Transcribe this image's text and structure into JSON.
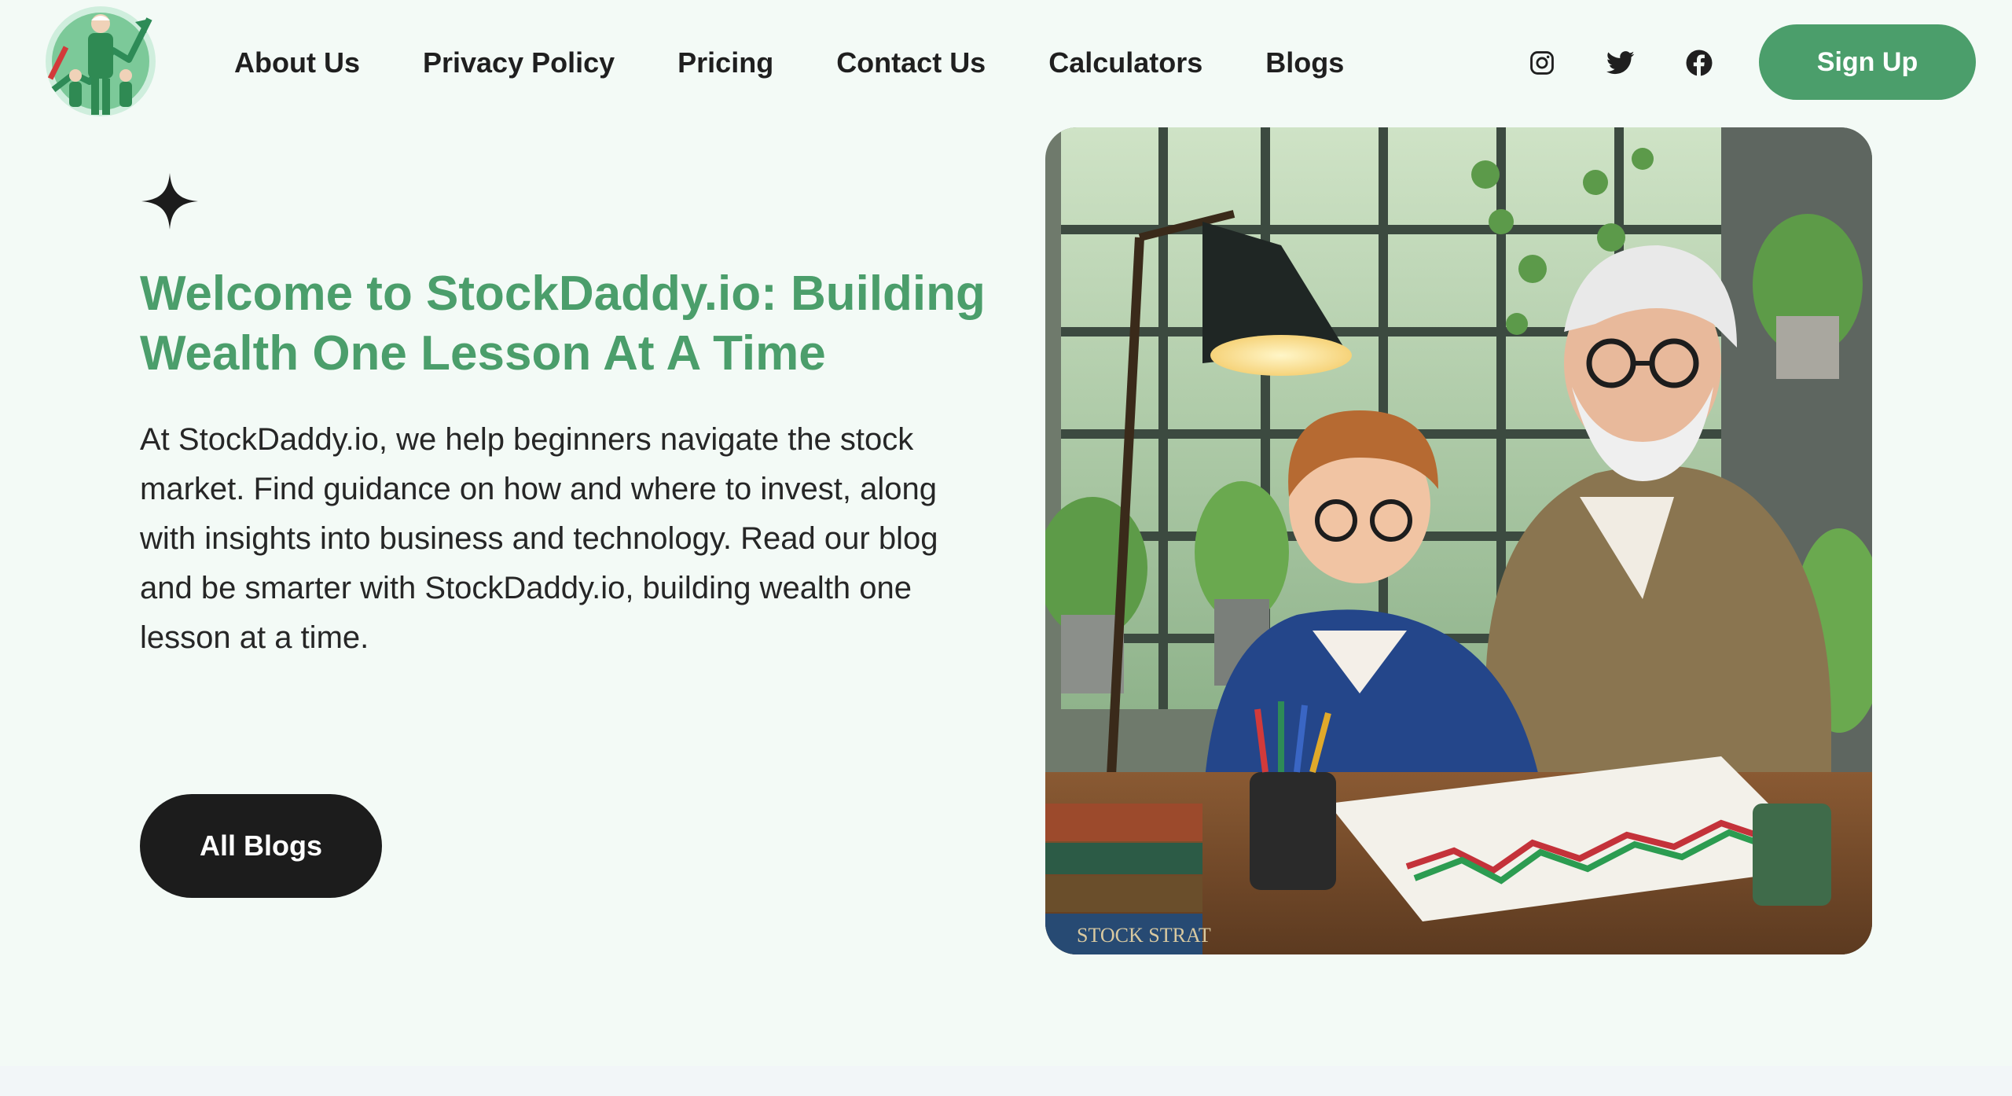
{
  "header": {
    "logo_icon": "stockdaddy-logo-icon",
    "nav": [
      {
        "label": "About Us"
      },
      {
        "label": "Privacy Policy"
      },
      {
        "label": "Pricing"
      },
      {
        "label": "Contact Us"
      },
      {
        "label": "Calculators"
      },
      {
        "label": "Blogs"
      }
    ],
    "social_icons": [
      "instagram-icon",
      "twitter-icon",
      "facebook-icon"
    ],
    "signup_label": "Sign Up"
  },
  "hero": {
    "title": "Welcome to StockDaddy.io: Building Wealth One Lesson At A Time",
    "text": "At StockDaddy.io, we help beginners navigate the stock market. Find guidance on how and where to invest, along with insights into business and technology. Read our blog and be smarter with StockDaddy.io, building wealth one lesson at a time.",
    "button_label": "All Blogs",
    "image_books_label": "STOCK STRAT"
  },
  "colors": {
    "background": "#f3faf6",
    "accent_green": "#4b9e6b",
    "dark_button": "#1c1c1c",
    "nav_text": "#1f1f1f"
  }
}
